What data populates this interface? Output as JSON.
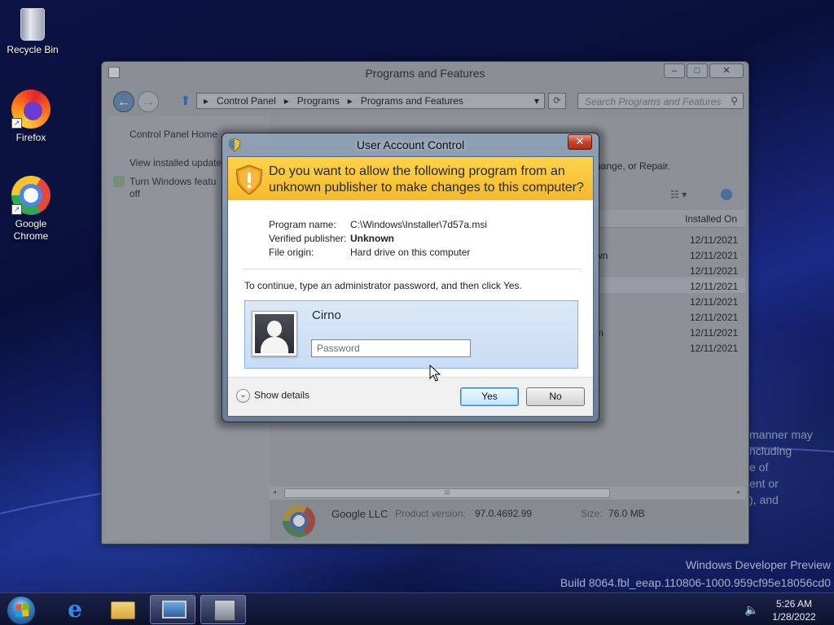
{
  "desktop": {
    "icons": [
      {
        "label": "Recycle Bin",
        "icon": "recycle-bin-icon"
      },
      {
        "label": "Firefox",
        "icon": "firefox-icon"
      },
      {
        "label": "Google Chrome",
        "icon": "chrome-icon"
      }
    ],
    "watermark": {
      "line1": "Windows Developer Preview",
      "line2": "Build 8064.fbl_eeap.110806-1000.959cf95e18056cd0"
    },
    "background_text": [
      "manner may",
      "ncluding",
      "e of",
      "ent or",
      "), and"
    ]
  },
  "programs_window": {
    "title": "Programs and Features",
    "controls": {
      "minimize": "–",
      "maximize": "□",
      "close": "✕"
    },
    "breadcrumb": [
      "Control Panel",
      "Programs",
      "Programs and Features"
    ],
    "search_placeholder": "Search Programs and Features",
    "left_links": {
      "home": "Control Panel Home",
      "updates": "View installed update",
      "features_1": "Turn Windows featu",
      "features_2": "off"
    },
    "top_text": "hange, or Repair.",
    "column_installed_on": "Installed On",
    "partial_names": [
      "wn",
      "m"
    ],
    "installed_dates": [
      "12/11/2021",
      "12/11/2021",
      "12/11/2021",
      "12/11/2021",
      "12/11/2021",
      "12/11/2021",
      "12/11/2021",
      "12/11/2021"
    ],
    "scroll_grip": "III",
    "details": {
      "publisher": "Google LLC",
      "product_version_label": "Product version:",
      "product_version": "97.0.4692.99",
      "size_label": "Size:",
      "size": "76.0 MB"
    }
  },
  "uac": {
    "title": "User Account Control",
    "close_glyph": "✕",
    "question": "Do you want to allow the following program from an unknown publisher to make changes to this computer?",
    "program_name_label": "Program name:",
    "program_name": "C:\\Windows\\Installer\\7d57a.msi",
    "publisher_label": "Verified publisher:",
    "publisher": "Unknown",
    "origin_label": "File origin:",
    "origin": "Hard drive on this computer",
    "instruction": "To continue, type an administrator password, and then click Yes.",
    "username": "Cirno",
    "password_placeholder": "Password",
    "password_value": "",
    "show_details": "Show details",
    "yes_label": "Yes",
    "no_label": "No"
  },
  "taskbar": {
    "clock_time": "5:26 AM",
    "clock_date": "1/28/2022",
    "pinned": [
      "internet-explorer-icon",
      "file-explorer-icon",
      "control-panel-icon",
      "setup-icon"
    ],
    "active_index": 3
  },
  "colors": {
    "uac_banner": "#f6b92b",
    "accent_blue": "#3c7fb1",
    "desktop_bg": "#0c1447"
  }
}
